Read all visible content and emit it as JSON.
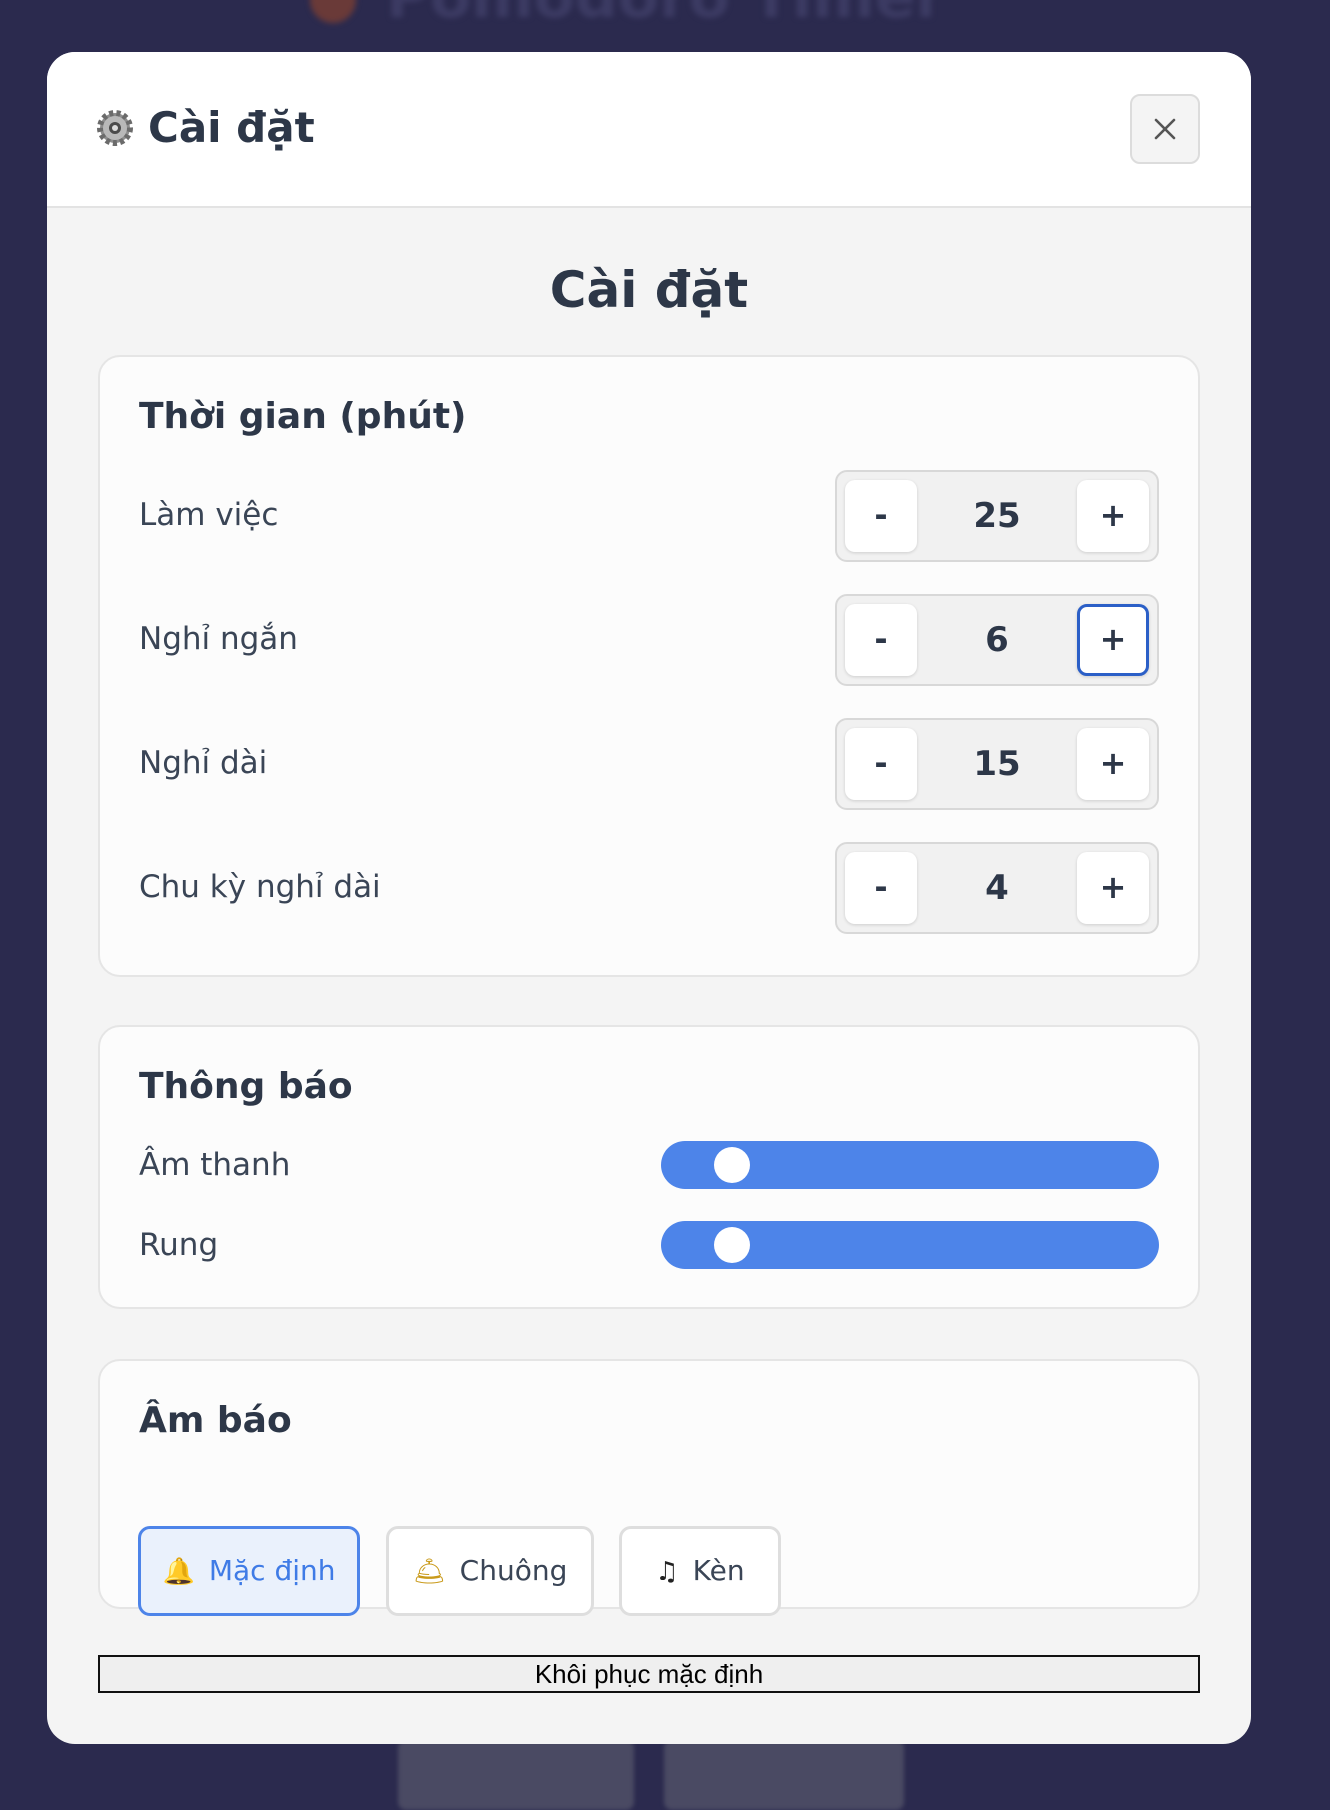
{
  "background": {
    "app_title": "Pomodoro Timer"
  },
  "modal": {
    "header_title": "Cài đặt",
    "header_icon": "gear-icon",
    "close_icon": "close-icon",
    "body_title": "Cài đặt"
  },
  "time_section": {
    "title": "Thời gian (phút)",
    "rows": [
      {
        "label": "Làm việc",
        "value": "25",
        "minus": "-",
        "plus": "+"
      },
      {
        "label": "Nghỉ ngắn",
        "value": "6",
        "minus": "-",
        "plus": "+"
      },
      {
        "label": "Nghỉ dài",
        "value": "15",
        "minus": "-",
        "plus": "+"
      },
      {
        "label": "Chu kỳ nghỉ dài",
        "value": "4",
        "minus": "-",
        "plus": "+"
      }
    ]
  },
  "notification_section": {
    "title": "Thông báo",
    "sound_label": "Âm thanh",
    "vibrate_label": "Rung",
    "accent_color": "#4d84e9"
  },
  "alarm_section": {
    "title": "Âm báo",
    "options": [
      {
        "label": "Mặc định",
        "icon": "bell-icon",
        "glyph": "🔔",
        "selected": true
      },
      {
        "label": "Chuông",
        "icon": "service-bell-icon",
        "glyph": "🛎",
        "selected": false
      },
      {
        "label": "Kèn",
        "icon": "music-note-icon",
        "glyph": "♫",
        "selected": false
      }
    ]
  },
  "reset_label": "Khôi phục mặc định"
}
